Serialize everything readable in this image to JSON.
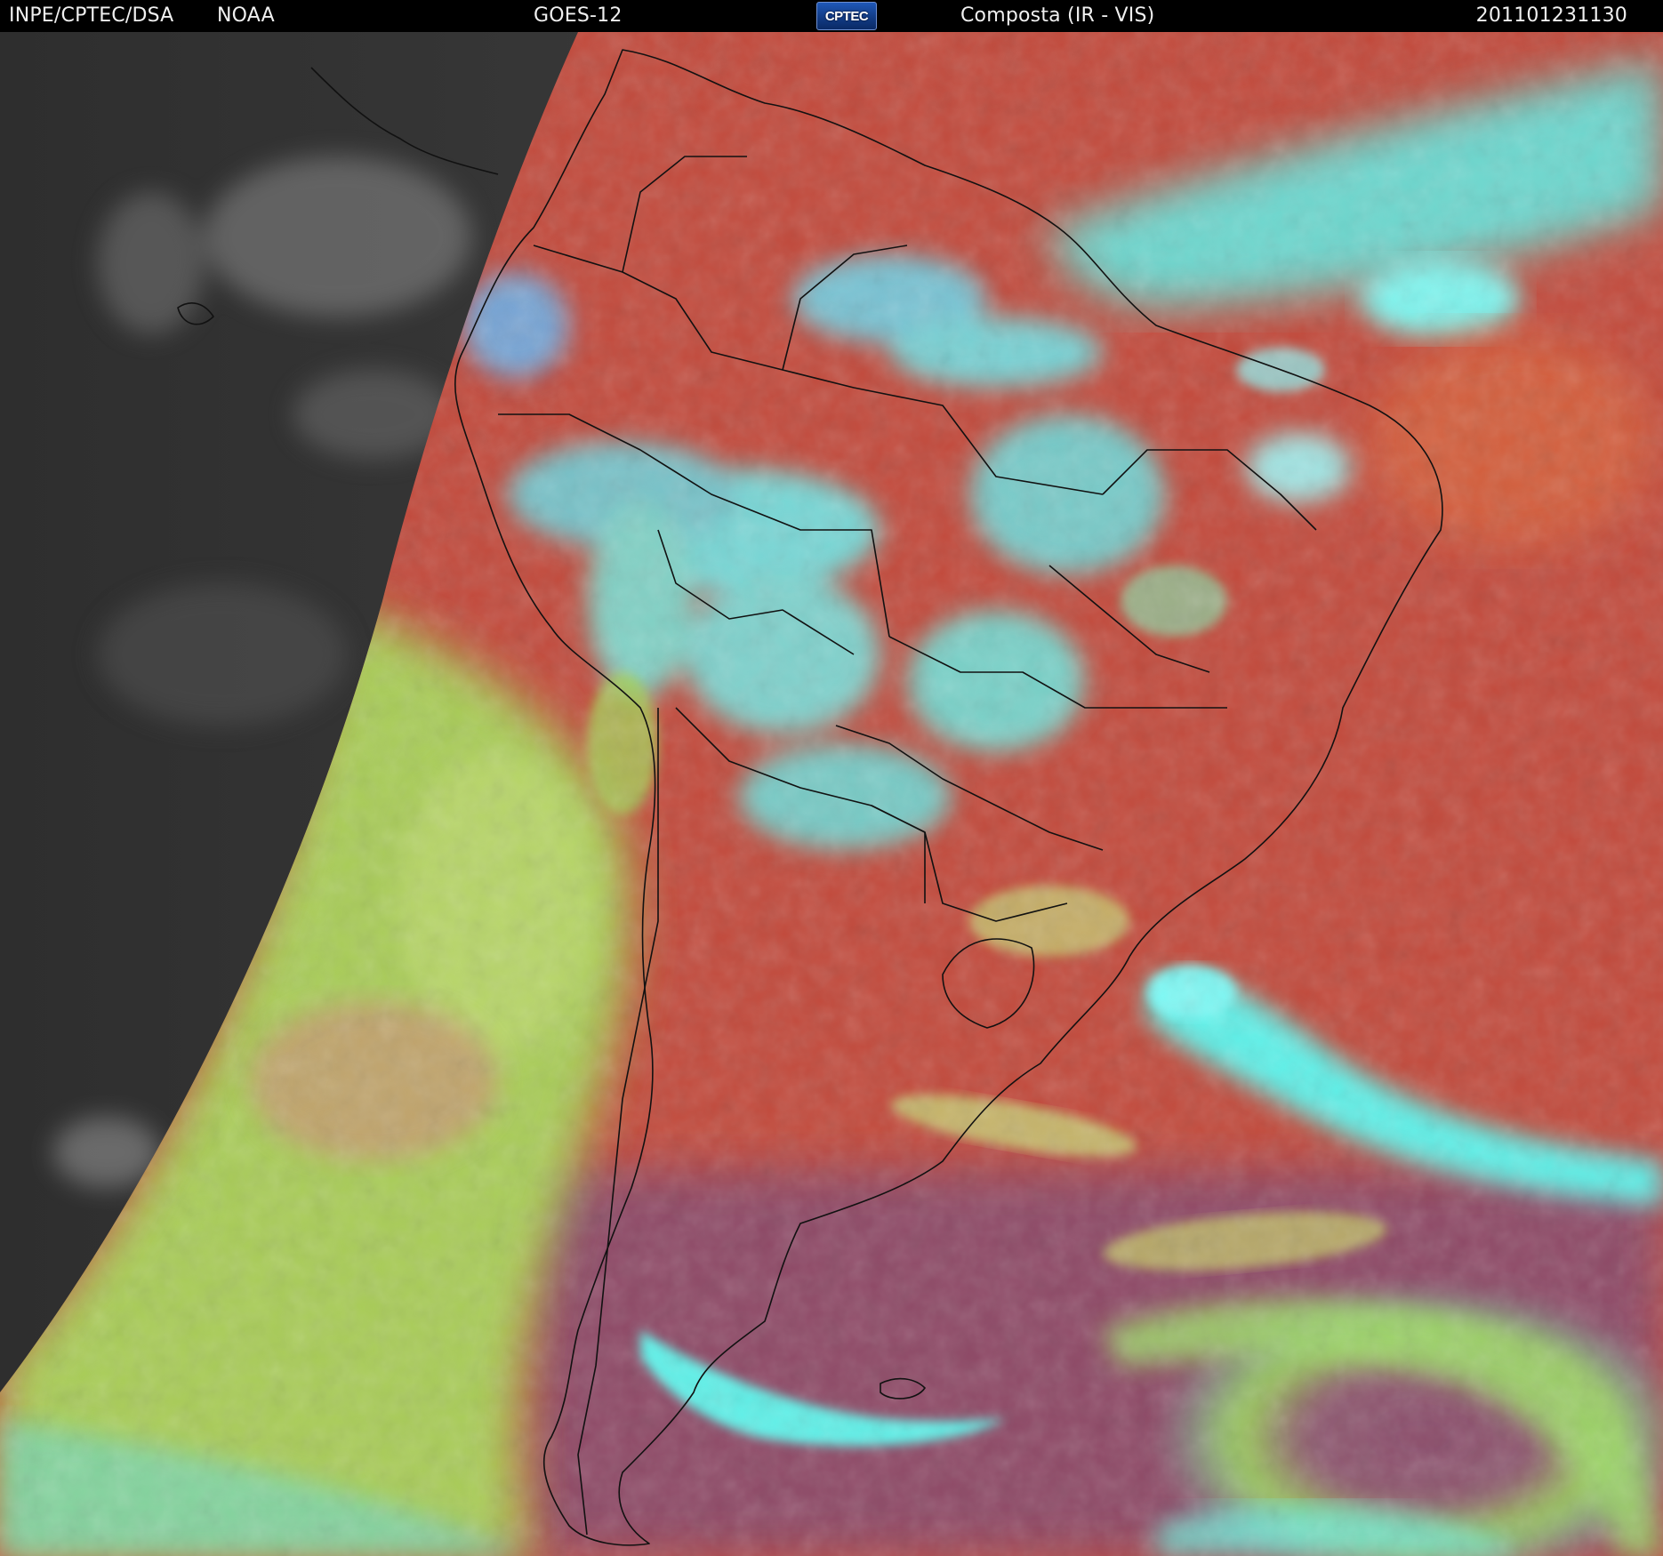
{
  "header": {
    "org": "INPE/CPTEC/DSA",
    "agency": "NOAA",
    "satellite": "GOES-12",
    "logo_text": "CPTEC",
    "product": "Composta (IR - VIS)",
    "timestamp": "201101231130"
  },
  "colors": {
    "background": "#000000",
    "header_text": "#f0f0f0",
    "night_side": "#3a3a3a",
    "land_clear": "#b8423a",
    "ocean_clear": "#c24a3c",
    "cold_cloud": "#5ff0e8",
    "low_cloud": "#a6d65a",
    "southern_ocean": "#8e4a66",
    "borders": "#111111"
  }
}
